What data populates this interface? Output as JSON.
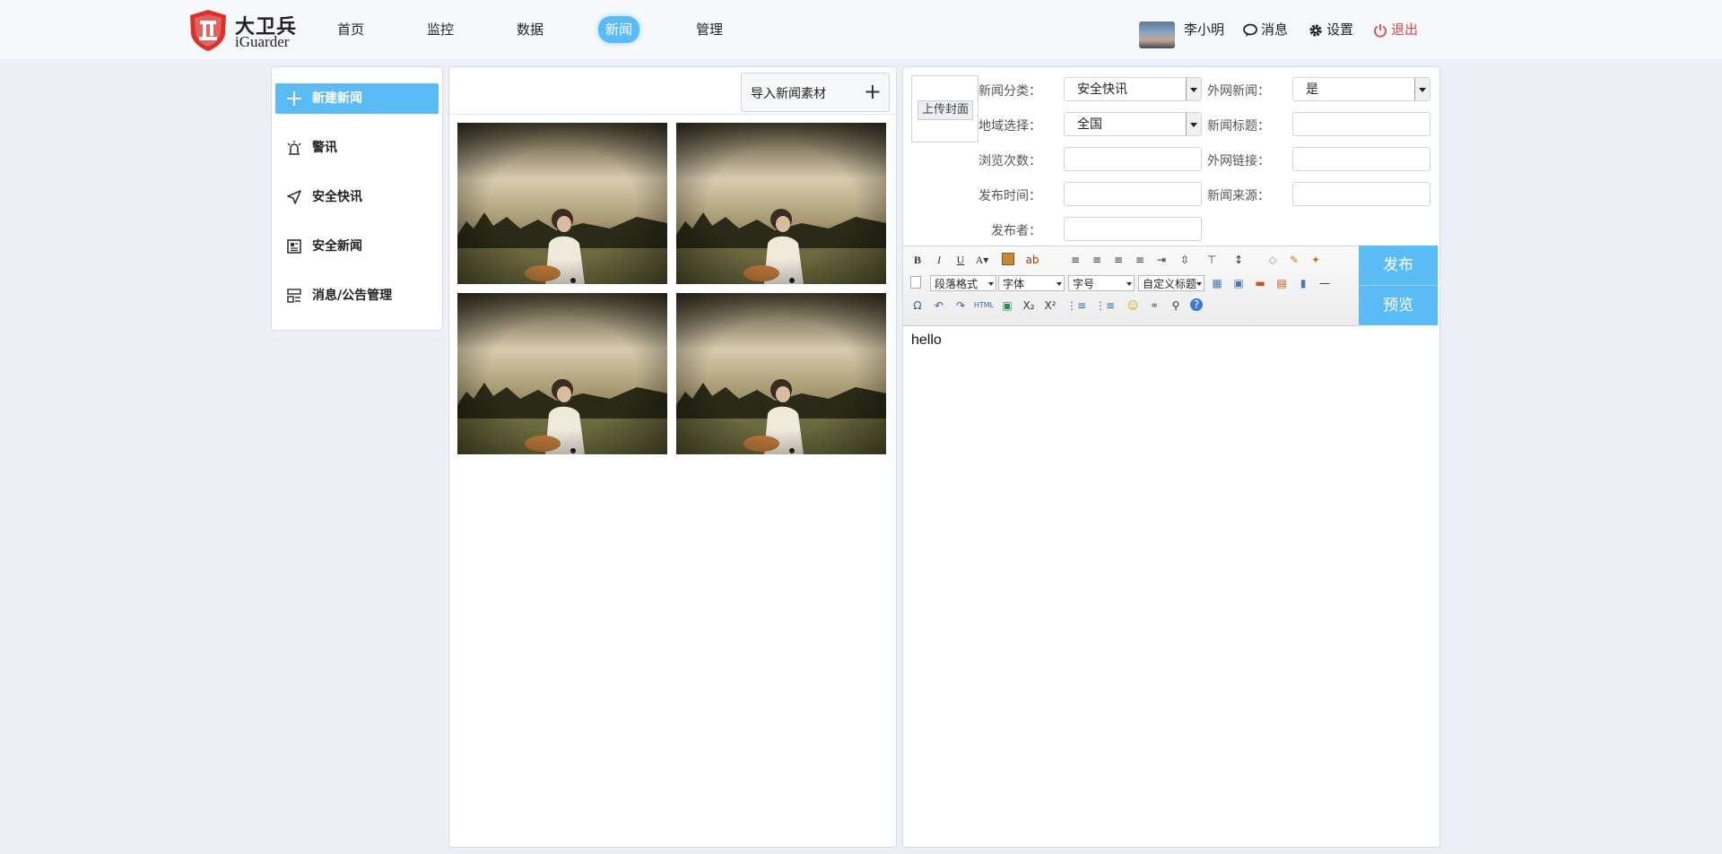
{
  "brand": {
    "name_cn": "大卫兵",
    "name_en": "iGuarder"
  },
  "nav": [
    {
      "label": "首页",
      "active": false
    },
    {
      "label": "监控",
      "active": false
    },
    {
      "label": "数据",
      "active": false
    },
    {
      "label": "新闻",
      "active": true
    },
    {
      "label": "管理",
      "active": false
    }
  ],
  "user": {
    "name": "李小明",
    "messages": "消息",
    "settings": "设置",
    "logout": "退出"
  },
  "sidebar": [
    {
      "label": "新建新闻",
      "icon": "plus-icon",
      "active": true
    },
    {
      "label": "警讯",
      "icon": "siren-icon",
      "active": false
    },
    {
      "label": "安全快讯",
      "icon": "send-icon",
      "active": false
    },
    {
      "label": "安全新闻",
      "icon": "newspaper-icon",
      "active": false
    },
    {
      "label": "消息/公告管理",
      "icon": "layout-icon",
      "active": false
    }
  ],
  "media": {
    "import_label": "导入新闻素材",
    "thumbnail_count": 4
  },
  "form": {
    "cover_button": "上传封面",
    "category_label": "新闻分类：",
    "category_value": "安全快讯",
    "external_label": "外网新闻：",
    "external_value": "是",
    "region_label": "地域选择：",
    "region_value": "全国",
    "title_label": "新闻标题：",
    "title_value": "",
    "views_label": "浏览次数：",
    "views_value": "",
    "link_label": "外网链接：",
    "link_value": "",
    "publish_time_label": "发布时间：",
    "publish_time_value": "",
    "source_label": "新闻来源：",
    "source_value": "",
    "publisher_label": "发布者：",
    "publisher_value": ""
  },
  "editor": {
    "paragraph_format": "段落格式",
    "font_family": "字体",
    "font_size": "字号",
    "custom_title": "自定义标题",
    "html_label": "HTML",
    "content": "hello",
    "publish_label": "发布",
    "preview_label": "预览"
  },
  "colors": {
    "accent": "#5bbcf5",
    "logout": "#e04545",
    "brand_red": "#d9312c"
  }
}
